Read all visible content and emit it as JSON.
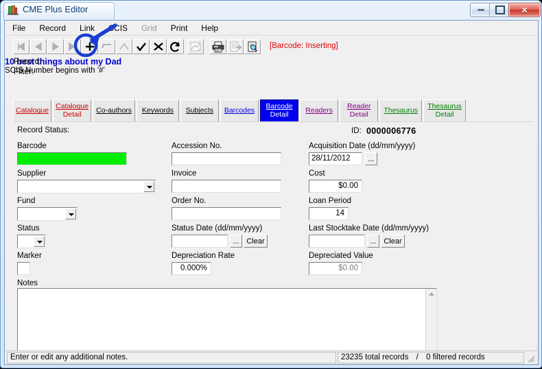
{
  "window": {
    "title": "CME Plus Editor",
    "app_icon": "app-icon",
    "controls": {
      "minimize": "minimize",
      "maximize": "maximize",
      "close": "close"
    }
  },
  "menu": [
    {
      "label": "File",
      "disabled": false
    },
    {
      "label": "Record",
      "disabled": false
    },
    {
      "label": "Link",
      "disabled": false
    },
    {
      "label": "SCIS",
      "disabled": false
    },
    {
      "label": "Grid",
      "disabled": true
    },
    {
      "label": "Print",
      "disabled": false
    },
    {
      "label": "Help",
      "disabled": false
    }
  ],
  "toolbar": {
    "buttons": [
      {
        "name": "first-record-button",
        "icon": "nav-first-icon",
        "enabled": false
      },
      {
        "name": "previous-record-button",
        "icon": "nav-previous-icon",
        "enabled": false
      },
      {
        "name": "next-record-button",
        "icon": "nav-next-icon",
        "enabled": false
      },
      {
        "name": "last-record-button",
        "icon": "nav-last-icon",
        "enabled": false
      },
      {
        "name": "add-record-button",
        "icon": "plus-icon",
        "enabled": true
      },
      {
        "name": "delete-record-button",
        "icon": "minus-icon",
        "enabled": false
      },
      {
        "name": "edit-record-button",
        "icon": "edit-caret-icon",
        "enabled": false
      },
      {
        "name": "post-edit-button",
        "icon": "check-icon",
        "enabled": true
      },
      {
        "name": "cancel-edit-button",
        "icon": "cross-icon",
        "enabled": true
      },
      {
        "name": "refresh-button",
        "icon": "refresh-icon",
        "enabled": true
      },
      {
        "name": "chart-button",
        "icon": "chart-icon",
        "enabled": false
      },
      {
        "name": "print-button",
        "icon": "printer-icon",
        "enabled": true
      },
      {
        "name": "report-button",
        "icon": "report-icon",
        "enabled": false
      },
      {
        "name": "print-preview-button",
        "icon": "preview-magnifier-icon",
        "enabled": true
      }
    ],
    "status_message": "[Barcode: Inserting]",
    "status_color": "#e00000"
  },
  "record_info": {
    "record_label": "Record:",
    "record_value": "10 best things about my Dad",
    "record_value_color": "#0000d0",
    "filter_label": "Filter:",
    "filter_value": "SCIS Number begins with '#'"
  },
  "tabs": [
    {
      "name": "tab-catalogue",
      "line1": "Catalogue",
      "line2": "",
      "color": "#d00000",
      "selected": false
    },
    {
      "name": "tab-catalogue-detail",
      "line1": "Catalogue",
      "line2": "Detail",
      "color": "#d00000",
      "selected": false
    },
    {
      "name": "tab-co-authors",
      "line1": "Co-authors",
      "line2": "",
      "color": "#000000",
      "selected": false
    },
    {
      "name": "tab-keywords",
      "line1": "Keywords",
      "line2": "",
      "color": "#000000",
      "selected": false
    },
    {
      "name": "tab-subjects",
      "line1": "Subjects",
      "line2": "",
      "color": "#000000",
      "selected": false
    },
    {
      "name": "tab-barcodes",
      "line1": "Barcodes",
      "line2": "",
      "color": "#0000dd",
      "selected": false
    },
    {
      "name": "tab-barcode-detail",
      "line1": "Barcode",
      "line2": "Detail",
      "color": "#ffffff",
      "selected": true
    },
    {
      "name": "tab-readers",
      "line1": "Readers",
      "line2": "",
      "color": "#880088",
      "selected": false
    },
    {
      "name": "tab-reader-detail",
      "line1": "Reader",
      "line2": "Detail",
      "color": "#880088",
      "selected": false
    },
    {
      "name": "tab-thesaurus",
      "line1": "Thesaurus",
      "line2": "",
      "color": "#008000",
      "selected": false
    },
    {
      "name": "tab-thesaurus-detail",
      "line1": "Thesaurus",
      "line2": "Detail",
      "color": "#008000",
      "selected": false
    }
  ],
  "form": {
    "record_status_label": "Record Status:",
    "record_status_value": "",
    "id_label": "ID:",
    "id_value": "0000006776",
    "fields": {
      "barcode": {
        "label": "Barcode",
        "value": ""
      },
      "supplier": {
        "label": "Supplier",
        "value": ""
      },
      "fund": {
        "label": "Fund",
        "value": ""
      },
      "status": {
        "label": "Status",
        "value": ""
      },
      "marker": {
        "label": "Marker",
        "value": ""
      },
      "notes": {
        "label": "Notes",
        "value": ""
      },
      "accession_no": {
        "label": "Accession No.",
        "value": ""
      },
      "invoice": {
        "label": "Invoice",
        "value": ""
      },
      "order_no": {
        "label": "Order No.",
        "value": ""
      },
      "status_date": {
        "label": "Status Date (dd/mm/yyyy)",
        "value": ""
      },
      "depreciation_rate": {
        "label": "Depreciation Rate",
        "value": "0.000%"
      },
      "acquisition_date": {
        "label": "Acquisition Date (dd/mm/yyyy)",
        "value": "28/11/2012"
      },
      "cost": {
        "label": "Cost",
        "value": "$0.00"
      },
      "loan_period": {
        "label": "Loan Period",
        "value": "14"
      },
      "last_stocktake": {
        "label": "Last Stocktake Date (dd/mm/yyyy)",
        "value": ""
      },
      "depreciated_value": {
        "label": "Depreciated Value",
        "value": "$0.00"
      }
    },
    "buttons": {
      "ellipsis": "...",
      "clear": "Clear"
    },
    "barcode_field_color": "#00ee00"
  },
  "statusbar": {
    "hint": "Enter or edit any additional notes.",
    "total_records": "23235 total records",
    "separator": "/",
    "filtered_records": "0 filtered records"
  },
  "annotation": {
    "highlight_target": "add-record-button",
    "color": "#1a3fd0",
    "shape": "circle-with-arrow"
  }
}
